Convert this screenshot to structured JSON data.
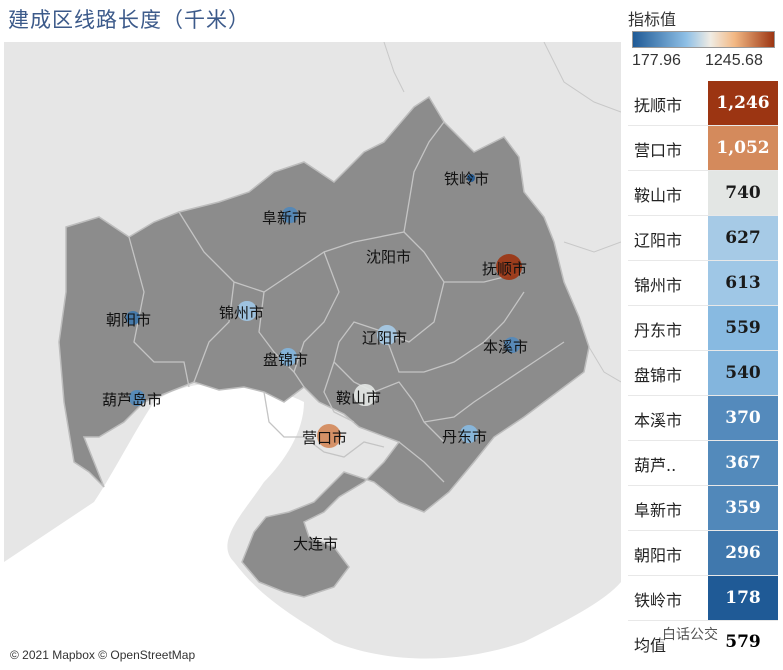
{
  "title": "建成区线路长度（千米）",
  "legend": {
    "title": "指标值",
    "min_label": "177.96",
    "max_label": "1245.68",
    "min": 177.96,
    "max": 1245.68,
    "colors": {
      "low": "#1f5a96",
      "mid_low": "#8fc0e6",
      "mid": "#f0ece4",
      "mid_high": "#f2b884",
      "high": "#9c3512"
    }
  },
  "map": {
    "copyright": "© 2021 Mapbox © OpenStreetMap",
    "land_color": "#8c8c8c",
    "sea_color": "#ffffff",
    "background": "#e6e6e6",
    "cities": [
      {
        "name": "铁岭市",
        "value": 178
      },
      {
        "name": "阜新市",
        "value": 359
      },
      {
        "name": "沈阳市",
        "value": null
      },
      {
        "name": "抚顺市",
        "value": 1246
      },
      {
        "name": "朝阳市",
        "value": 296
      },
      {
        "name": "锦州市",
        "value": 613
      },
      {
        "name": "辽阳市",
        "value": 627
      },
      {
        "name": "本溪市",
        "value": 370
      },
      {
        "name": "盘锦市",
        "value": 540
      },
      {
        "name": "葫芦岛市",
        "value": 367
      },
      {
        "name": "鞍山市",
        "value": 740
      },
      {
        "name": "营口市",
        "value": 1052
      },
      {
        "name": "丹东市",
        "value": 559
      },
      {
        "name": "大连市",
        "value": null
      }
    ]
  },
  "table": {
    "rows": [
      {
        "name": "抚顺市",
        "value_label": "1,246",
        "value": 1246
      },
      {
        "name": "营口市",
        "value_label": "1,052",
        "value": 1052
      },
      {
        "name": "鞍山市",
        "value_label": "740",
        "value": 740
      },
      {
        "name": "辽阳市",
        "value_label": "627",
        "value": 627
      },
      {
        "name": "锦州市",
        "value_label": "613",
        "value": 613
      },
      {
        "name": "丹东市",
        "value_label": "559",
        "value": 559
      },
      {
        "name": "盘锦市",
        "value_label": "540",
        "value": 540
      },
      {
        "name": "本溪市",
        "value_label": "370",
        "value": 370
      },
      {
        "name": "葫芦..",
        "value_label": "367",
        "value": 367
      },
      {
        "name": "阜新市",
        "value_label": "359",
        "value": 359
      },
      {
        "name": "朝阳市",
        "value_label": "296",
        "value": 296
      },
      {
        "name": "铁岭市",
        "value_label": "178",
        "value": 178
      }
    ],
    "average_label": "均值",
    "average_value_label": "579"
  },
  "watermark": "白话公交"
}
